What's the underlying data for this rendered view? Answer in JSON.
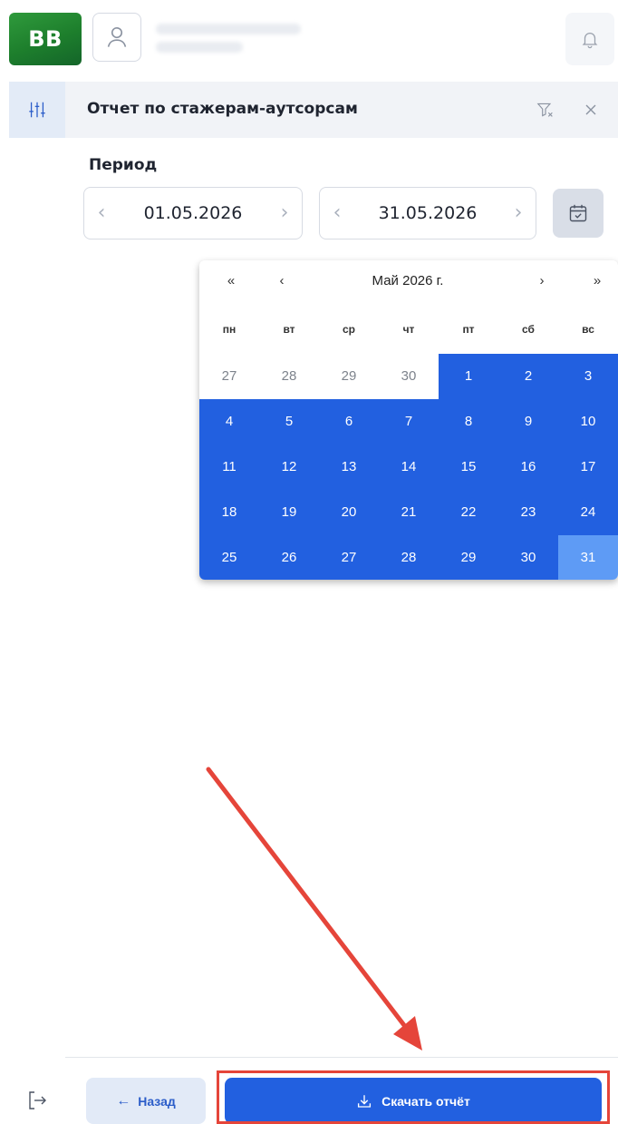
{
  "header": {
    "logo_text": "BB",
    "user_icon": "user-icon",
    "bell_icon": "bell-icon"
  },
  "sidebar": {
    "filter_icon": "filter-sliders-icon",
    "logout_icon": "logout-icon"
  },
  "panel": {
    "title": "Отчет по стажерам-аутсорсам",
    "clear_filter_icon": "filter-clear-icon",
    "close_icon": "close-icon",
    "period_label": "Период",
    "date_from": "01.05.2026",
    "date_to": "31.05.2026",
    "calendar_icon": "calendar-icon"
  },
  "calendar": {
    "nav_prev_year": "«",
    "nav_prev_month": "‹",
    "month_label": "Май 2026 г.",
    "nav_next_month": "›",
    "nav_next_year": "»",
    "weekdays": [
      "пн",
      "вт",
      "ср",
      "чт",
      "пт",
      "сб",
      "вс"
    ],
    "weeks": [
      [
        "27",
        "28",
        "29",
        "30",
        "1",
        "2",
        "3"
      ],
      [
        "4",
        "5",
        "6",
        "7",
        "8",
        "9",
        "10"
      ],
      [
        "11",
        "12",
        "13",
        "14",
        "15",
        "16",
        "17"
      ],
      [
        "18",
        "19",
        "20",
        "21",
        "22",
        "23",
        "24"
      ],
      [
        "25",
        "26",
        "27",
        "28",
        "29",
        "30",
        "31"
      ]
    ],
    "range_color": "#2260e0",
    "range_end_color": "#5e9bf5"
  },
  "footer": {
    "back_label": "Назад",
    "back_icon": "arrow-left-icon",
    "download_label": "Скачать отчёт",
    "download_icon": "download-icon"
  },
  "annotation": {
    "color": "#e5453a"
  }
}
